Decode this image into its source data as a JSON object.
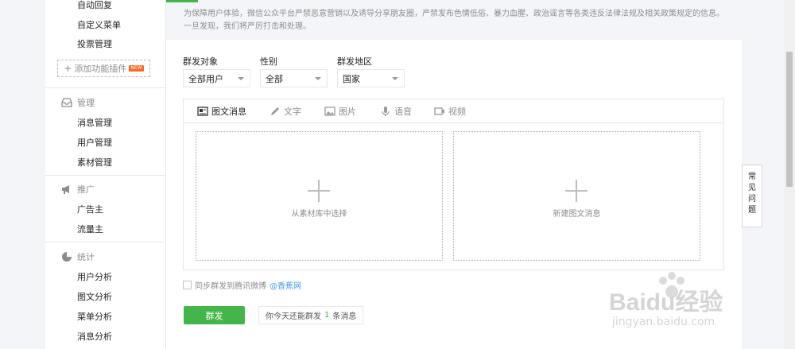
{
  "sidebar": {
    "top_items": [
      "自动回复",
      "自定义菜单",
      "投票管理"
    ],
    "add_plugin_label": "添加功能插件",
    "add_plugin_badge": "NEW",
    "groups": [
      {
        "title": "管理",
        "icon": "inbox-icon",
        "items": [
          "消息管理",
          "用户管理",
          "素材管理"
        ]
      },
      {
        "title": "推广",
        "icon": "megaphone-icon",
        "items": [
          "广告主",
          "流量主"
        ]
      },
      {
        "title": "统计",
        "icon": "pie-chart-icon",
        "items": [
          "用户分析",
          "图文分析",
          "菜单分析",
          "消息分析"
        ]
      }
    ]
  },
  "notice": {
    "text": "为保障用户体验，微信公众平台严禁恶意营销以及诱导分享朋友圈，严禁发布色情低俗、暴力血腥、政治谣言等各类违反法律法规及相关政策规定的信息。一旦发现，我们将严厉打击和处理。"
  },
  "filters": {
    "target_label": "群发对象",
    "target_value": "全部用户",
    "gender_label": "性别",
    "gender_value": "全部",
    "region_label": "群发地区",
    "region_value": "国家"
  },
  "tabs": [
    {
      "label": "图文消息",
      "icon": "article-icon",
      "active": true
    },
    {
      "label": "文字",
      "icon": "pencil-icon",
      "active": false
    },
    {
      "label": "图片",
      "icon": "image-icon",
      "active": false
    },
    {
      "label": "语音",
      "icon": "microphone-icon",
      "active": false
    },
    {
      "label": "视频",
      "icon": "video-icon",
      "active": false
    }
  ],
  "cards": {
    "from_library": "从素材库中选择",
    "create_new": "新建图文消息"
  },
  "sync": {
    "label": "同步群发到腾讯微博",
    "link": "@香蕉网"
  },
  "send_button": "群发",
  "quota": {
    "prefix": "你今天还能群发",
    "count": "1",
    "suffix": "条消息"
  },
  "faq": [
    "常",
    "见",
    "问",
    "题"
  ],
  "watermark": {
    "brand": "Baidu经验",
    "url": "jingyan.baidu.com"
  },
  "colors": {
    "accent": "#44b549",
    "link": "#459ae9",
    "muted": "#8d8d8d"
  }
}
